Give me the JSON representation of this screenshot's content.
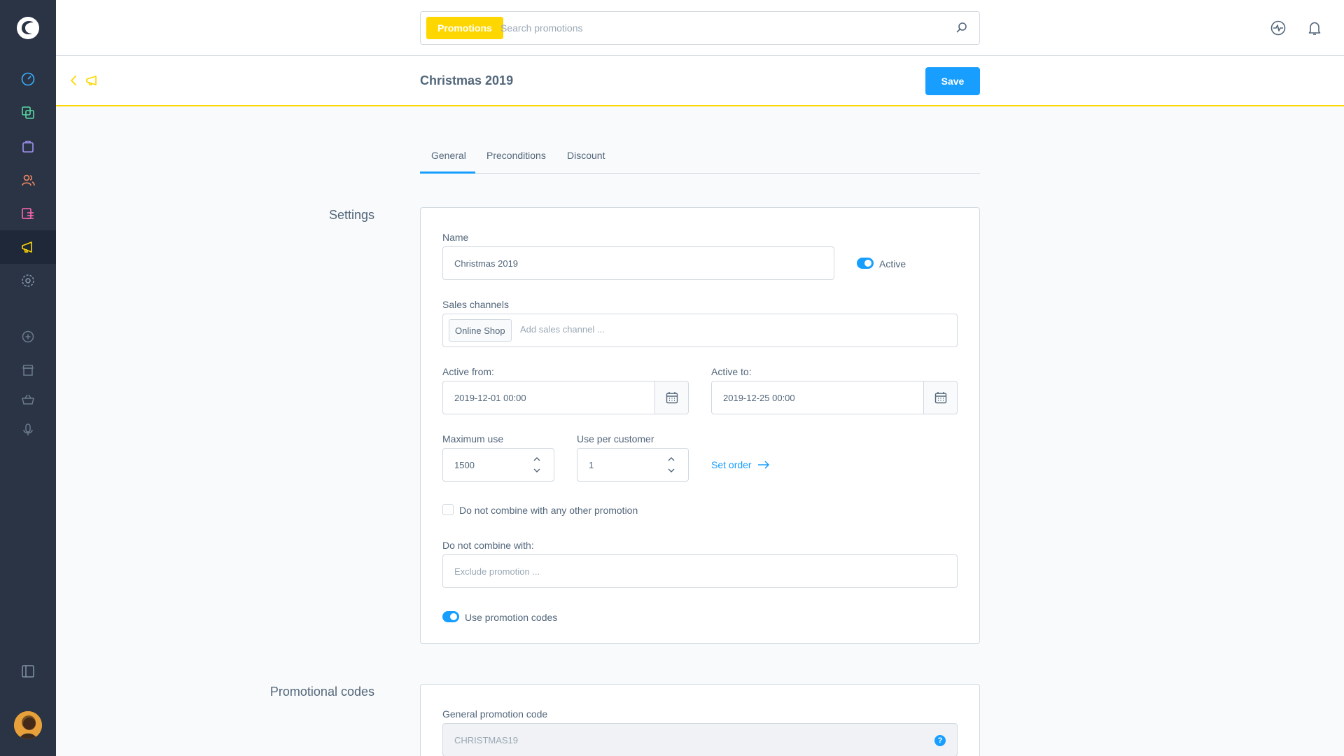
{
  "colors": {
    "accent": "#189eff",
    "brand_yellow": "#ffd700",
    "sidebar_bg": "#2b3445"
  },
  "sidebar": {
    "items": [
      {
        "icon": "dashboard-icon"
      },
      {
        "icon": "catalogues-icon"
      },
      {
        "icon": "orders-icon"
      },
      {
        "icon": "customers-icon"
      },
      {
        "icon": "content-icon"
      },
      {
        "icon": "marketing-icon"
      },
      {
        "icon": "settings-icon"
      },
      {
        "icon": "plus-circle-icon"
      },
      {
        "icon": "store-icon"
      },
      {
        "icon": "basket-icon"
      },
      {
        "icon": "microphone-icon"
      },
      {
        "icon": "collapse-sidebar-icon"
      }
    ]
  },
  "topbar": {
    "search_tag": "Promotions",
    "search_placeholder": "Search promotions"
  },
  "smartbar": {
    "title": "Christmas 2019",
    "save_label": "Save"
  },
  "tabs": [
    {
      "label": "General"
    },
    {
      "label": "Preconditions"
    },
    {
      "label": "Discount"
    }
  ],
  "settings": {
    "section_label": "Settings",
    "name_label": "Name",
    "name_value": "Christmas 2019",
    "active_label": "Active",
    "sales_channels_label": "Sales channels",
    "sales_channel_chip": "Online Shop",
    "sales_channel_placeholder": "Add sales channel ...",
    "active_from_label": "Active from:",
    "active_from_value": "2019-12-01 00:00",
    "active_to_label": "Active to:",
    "active_to_value": "2019-12-25 00:00",
    "max_use_label": "Maximum use",
    "max_use_value": "1500",
    "use_per_customer_label": "Use per customer",
    "use_per_customer_value": "1",
    "set_order_label": "Set order",
    "no_combine_label": "Do not combine with any other promotion",
    "do_not_combine_with_label": "Do not combine with:",
    "exclude_placeholder": "Exclude promotion ...",
    "use_codes_label": "Use promotion codes"
  },
  "codes": {
    "section_label": "Promotional codes",
    "general_code_label": "General promotion code",
    "general_code_value": "CHRISTMAS19",
    "help_glyph": "?"
  }
}
